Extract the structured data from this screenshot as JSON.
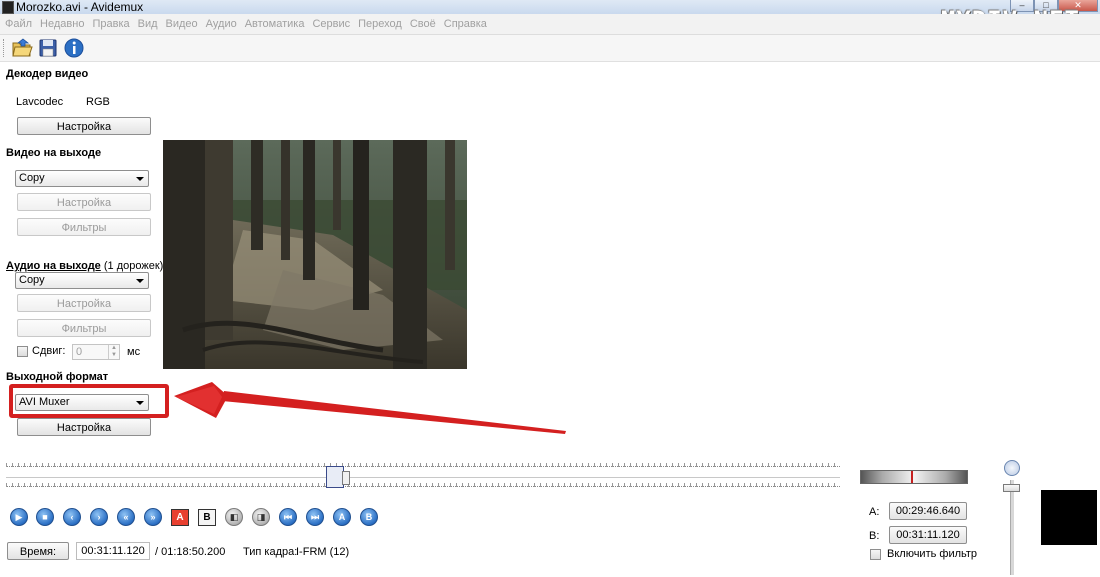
{
  "window": {
    "title": "Morozko.avi - Avidemux",
    "watermark": "MYDIV.NET",
    "controls": [
      "–",
      "□",
      "✕"
    ]
  },
  "menu": [
    "Файл",
    "Недавно",
    "Правка",
    "Вид",
    "Видео",
    "Аудио",
    "Автоматика",
    "Сервис",
    "Переход",
    "Своё",
    "Справка"
  ],
  "toolbar": {
    "icons": [
      "open-folder-icon",
      "save-disk-icon",
      "info-icon"
    ]
  },
  "video_decoder": {
    "title": "Декодер видео",
    "codec": "Lavcodec",
    "format": "RGB",
    "settings_label": "Настройка"
  },
  "video_output": {
    "title": "Видео на выходе",
    "codec_value": "Copy",
    "settings_label": "Настройка",
    "filters_label": "Фильтры"
  },
  "audio_output": {
    "title_main": "Аудио на выходе",
    "title_suffix": "(1 дорожек)",
    "codec_value": "Copy",
    "settings_label": "Настройка",
    "filters_label": "Фильтры",
    "shift_label": "Сдвиг:",
    "shift_value": "0",
    "shift_unit": "мс",
    "shift_checked": false
  },
  "output_format": {
    "title": "Выходной формат",
    "muxer_value": "AVI Muxer",
    "settings_label": "Настройка"
  },
  "timeline": {
    "position_fraction": 0.395
  },
  "controls": {
    "icons": [
      "play-icon",
      "stop-icon",
      "previous-frame-icon",
      "next-frame-icon",
      "previous-keyframe-icon",
      "next-keyframe-icon",
      "set-marker-a-icon",
      "set-marker-b-icon",
      "previous-black-frame-icon",
      "next-black-frame-icon",
      "goto-start-icon",
      "goto-end-icon",
      "goto-marker-a-icon",
      "goto-marker-b-icon"
    ],
    "marker_a_text": "A",
    "marker_b_text": "B"
  },
  "status": {
    "time_button": "Время:",
    "current_time": "00:31:11.120",
    "total_time": "/ 01:18:50.200",
    "frame_type_label": "Тип кадра:",
    "frame_type_value": "I-FRM (12)"
  },
  "selection": {
    "a_label": "A:",
    "a_value": "00:29:46.640",
    "b_label": "B:",
    "b_value": "00:31:11.120",
    "filter_label": "Включить фильтр",
    "filter_checked": false
  },
  "colors": {
    "highlight": "#d42020",
    "accent_blue": "#2b6fc4"
  }
}
